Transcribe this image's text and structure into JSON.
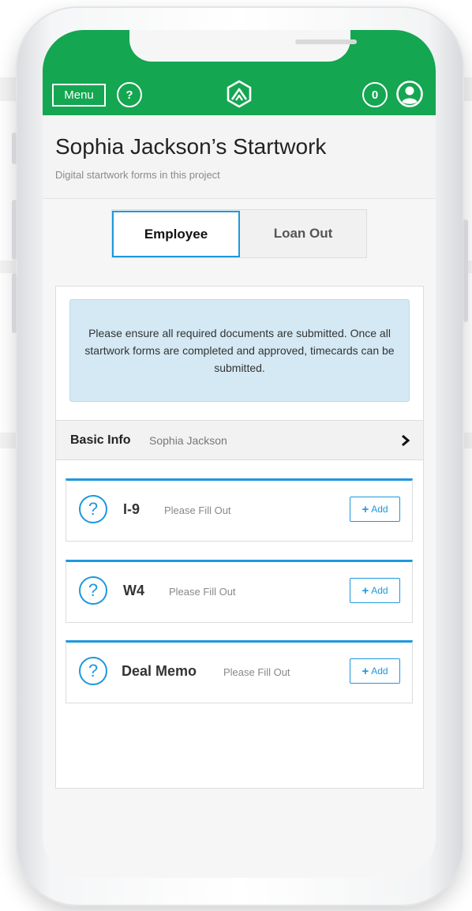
{
  "header": {
    "menu_label": "Menu",
    "help_label": "?",
    "notification_count": "0",
    "brand_color": "#14a651"
  },
  "page": {
    "title": "Sophia Jackson’s Startwork",
    "subtitle": "Digital startwork forms in this project"
  },
  "tabs": [
    {
      "label": "Employee",
      "active": true
    },
    {
      "label": "Loan Out",
      "active": false
    }
  ],
  "notice": {
    "text": "Please ensure all required documents are submitted. Once all startwork forms are completed and approved, timecards can be submitted."
  },
  "basic_info": {
    "label": "Basic Info",
    "value": "Sophia Jackson"
  },
  "forms": [
    {
      "icon": "?",
      "title": "I-9",
      "status": "Please Fill Out",
      "add_label": "Add"
    },
    {
      "icon": "?",
      "title": "W4",
      "status": "Please Fill Out",
      "add_label": "Add"
    },
    {
      "icon": "?",
      "title": "Deal Memo",
      "status": "Please Fill Out",
      "add_label": "Add"
    }
  ],
  "colors": {
    "accent": "#1d98dd",
    "notice_bg": "#d4e9f4"
  }
}
